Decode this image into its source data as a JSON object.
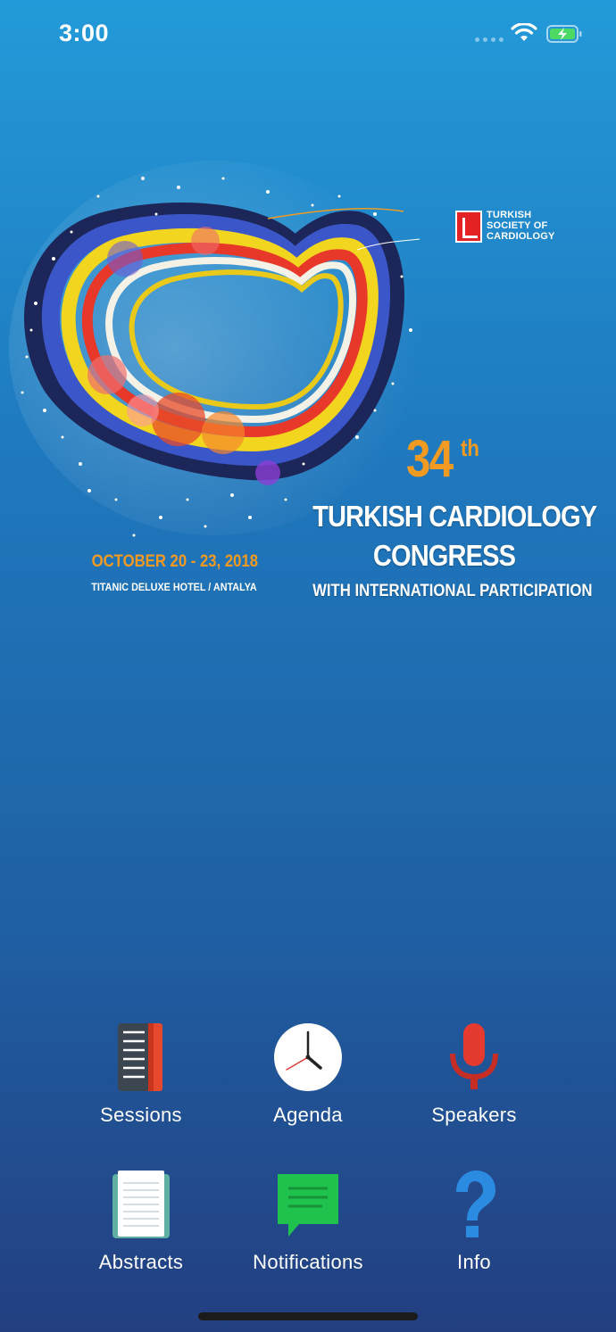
{
  "status_bar": {
    "time": "3:00"
  },
  "hero": {
    "society_logo": [
      "TURKISH",
      "SOCIETY OF",
      "CARDIOLOGY"
    ],
    "edition_number": "34",
    "edition_suffix": "th",
    "title_line1": "TURKISH CARDIOLOGY",
    "title_line2": "CONGRESS",
    "subtitle": "WITH INTERNATIONAL PARTICIPATION",
    "dates": "OCTOBER 20 - 23, 2018",
    "venue": "TITANIC DELUXE HOTEL / ANTALYA"
  },
  "menu": {
    "sessions": "Sessions",
    "agenda": "Agenda",
    "speakers": "Speakers",
    "abstracts": "Abstracts",
    "notifications": "Notifications",
    "info": "Info"
  }
}
